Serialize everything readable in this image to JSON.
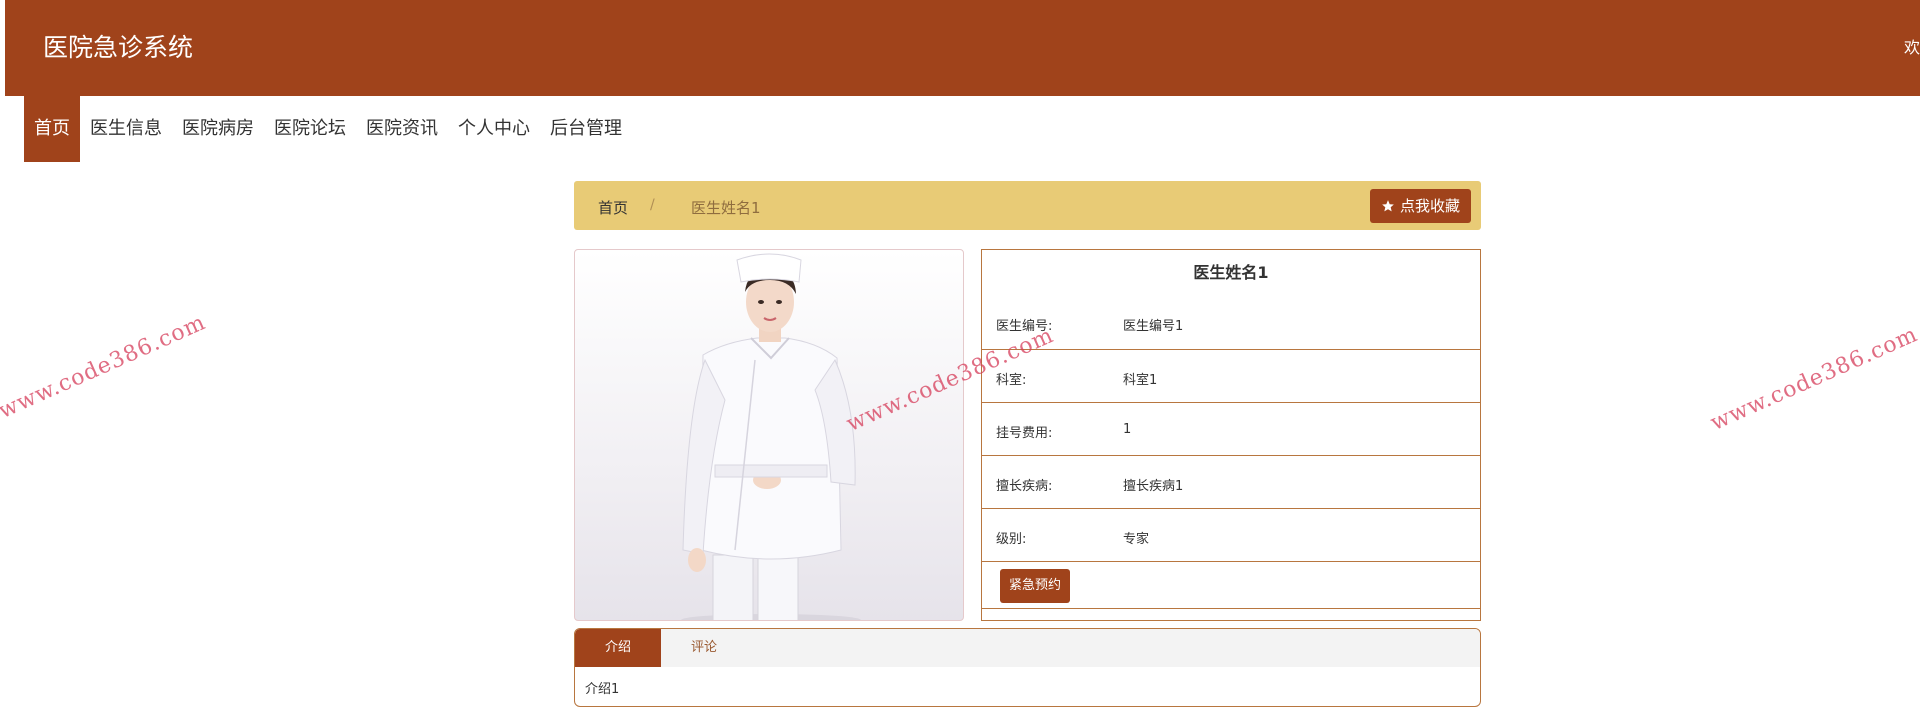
{
  "header": {
    "site_title": "医院急诊系统",
    "welcome": "欢"
  },
  "nav": {
    "items": [
      "首页",
      "医生信息",
      "医院病房",
      "医院论坛",
      "医院资讯",
      "个人中心",
      "后台管理"
    ],
    "active_index": 0
  },
  "breadcrumb": {
    "home": "首页",
    "separator": "/",
    "current": "医生姓名1"
  },
  "favorite_button": {
    "label": "点我收藏",
    "icon": "star-icon"
  },
  "doctor": {
    "name": "医生姓名1",
    "fields": [
      {
        "label": "医生编号:",
        "value": "医生编号1"
      },
      {
        "label": "科室:",
        "value": "科室1"
      },
      {
        "label": "挂号费用:",
        "value": "1"
      },
      {
        "label": "擅长疾病:",
        "value": "擅长疾病1"
      },
      {
        "label": "级别:",
        "value": "专家"
      }
    ],
    "action_label": "紧急预约"
  },
  "tabs": {
    "items": [
      "介绍",
      "评论"
    ],
    "active_index": 0,
    "content": "介绍1"
  },
  "watermark": {
    "text": "www.code386.com"
  },
  "colors": {
    "brand": "#a0431b",
    "breadcrumb_bg": "#e8cb76",
    "border": "#b8763f"
  }
}
